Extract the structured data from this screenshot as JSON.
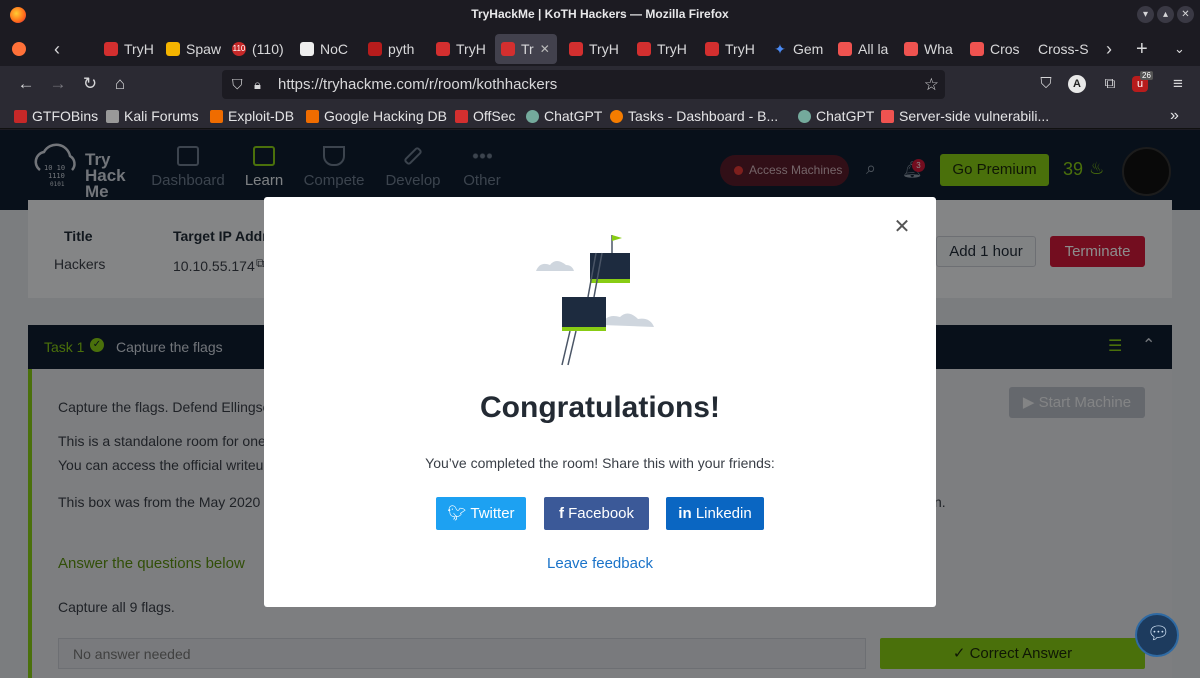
{
  "window": {
    "title": "TryHackMe | KoTH Hackers — Mozilla Firefox"
  },
  "tabs": [
    {
      "label": "TryH",
      "color": "#d32f2f"
    },
    {
      "label": "Spaw",
      "color": "#f4b400"
    },
    {
      "label": "(110)",
      "color": "#c62828",
      "badge": "110"
    },
    {
      "label": "NoC",
      "color": "#eeeeee"
    },
    {
      "label": "pyth",
      "color": "#b71c1c"
    },
    {
      "label": "TryH",
      "color": "#d32f2f"
    },
    {
      "label": "Tr",
      "color": "#d32f2f"
    },
    {
      "label": "TryH",
      "color": "#d32f2f"
    },
    {
      "label": "TryH",
      "color": "#d32f2f"
    },
    {
      "label": "TryH",
      "color": "#d32f2f"
    },
    {
      "label": "Gem",
      "color": "#4a8af4"
    },
    {
      "label": "All la",
      "color": "#ef5350"
    },
    {
      "label": "Wha",
      "color": "#ef5350"
    },
    {
      "label": "Cros",
      "color": "#ef5350"
    },
    {
      "label": "Cross-S",
      "color": ""
    }
  ],
  "address": {
    "url": "https://tryhackme.com/r/room/kothhackers"
  },
  "toolbar": {
    "ext_badge": "26"
  },
  "bookmarks": [
    {
      "label": "GTFOBins",
      "color": "#c62828"
    },
    {
      "label": "Kali Forums",
      "color": "#999999"
    },
    {
      "label": "Exploit-DB",
      "color": "#ef6c00"
    },
    {
      "label": "Google Hacking DB",
      "color": "#ef6c00"
    },
    {
      "label": "OffSec",
      "color": "#d32f2f"
    },
    {
      "label": "ChatGPT",
      "color": "#74aa9c"
    },
    {
      "label": "Tasks - Dashboard - B...",
      "color": "#f57c00"
    },
    {
      "label": "ChatGPT",
      "color": "#74aa9c"
    },
    {
      "label": "Server-side vulnerabili...",
      "color": "#ef5350"
    }
  ],
  "thm": {
    "logo": [
      "Try",
      "Hack",
      "Me"
    ],
    "nav": [
      "Dashboard",
      "Learn",
      "Compete",
      "Develop",
      "Other"
    ],
    "access_machines": "Access Machines",
    "notifications": "3",
    "go_premium": "Go Premium",
    "streak": "39"
  },
  "room": {
    "col_title": "Title",
    "col_ip": "Target IP Addre",
    "title": "Hackers",
    "ip": "10.10.55.174",
    "add_hour": "Add 1 hour",
    "terminate": "Terminate"
  },
  "task": {
    "label": "Task 1",
    "title": "Capture the flags",
    "line1": "Capture the flags. Defend Ellingson",
    "line2": "This is a standalone room for one o",
    "line3": "You can access the official writeup b",
    "line4": "This box was from the May 2020 KoT",
    "line4_end": "n.",
    "start_machine": "Start Machine",
    "answer_heading": "Answer the questions below",
    "question": "Capture all 9 flags.",
    "answer_placeholder": "No answer needed",
    "correct": "Correct Answer"
  },
  "modal": {
    "heading": "Congratulations!",
    "subtext": "You’ve completed the room! Share this with your friends:",
    "twitter": "Twitter",
    "facebook": "Facebook",
    "linkedin": "Linkedin",
    "feedback": "Leave feedback"
  },
  "colors": {
    "brand_green": "#88cc14",
    "navy": "#0f1e30",
    "terminate_red": "#d1193a",
    "twitter": "#1da1f2",
    "facebook": "#3b5998",
    "linkedin": "#0a66c2"
  }
}
